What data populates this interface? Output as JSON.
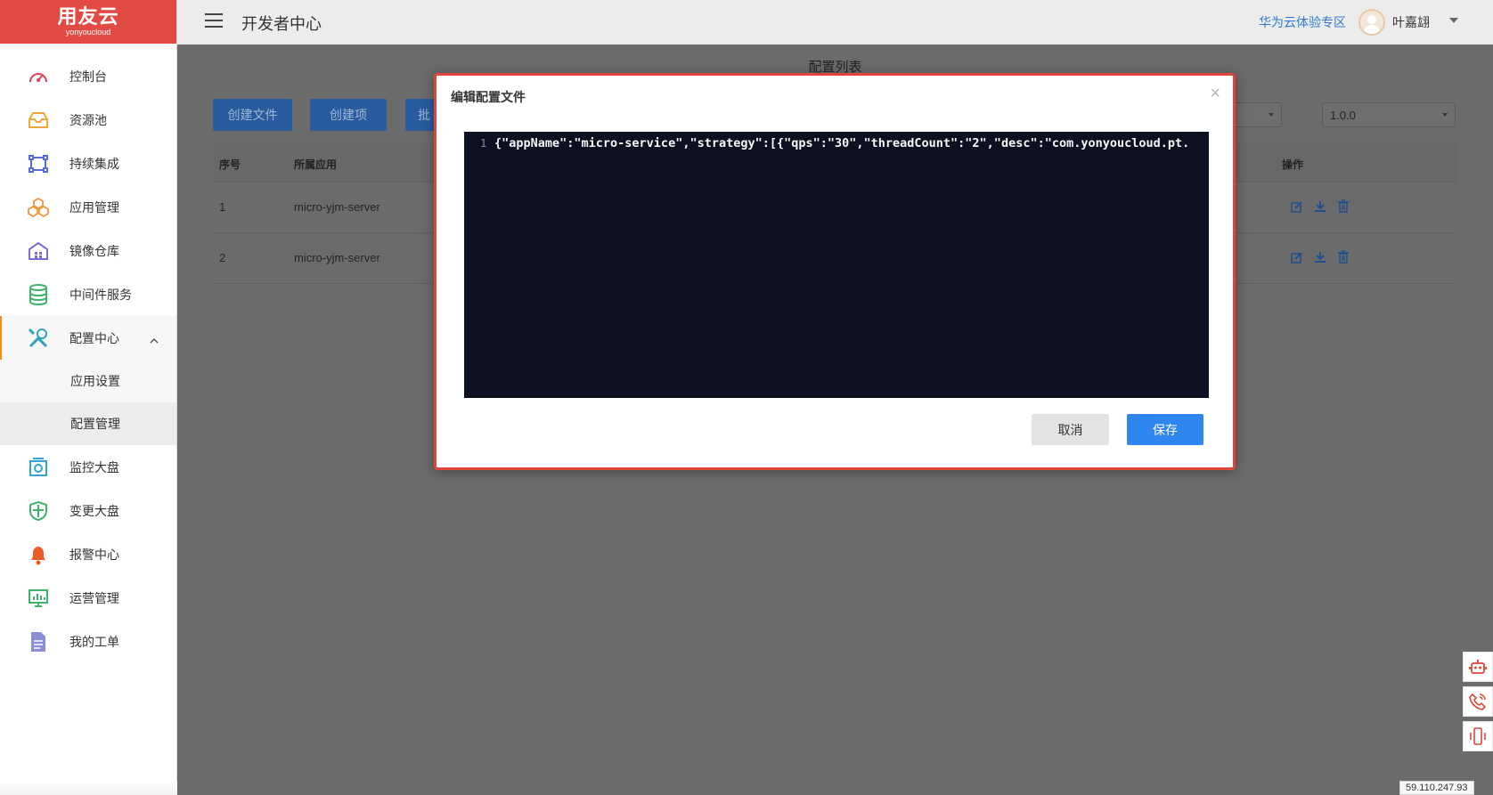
{
  "header": {
    "title": "开发者中心",
    "huawei_link": "华为云体验专区",
    "username": "叶嘉翃"
  },
  "logo": {
    "brand": "用友云",
    "sub": "yonyoucloud"
  },
  "sidebar": {
    "items": [
      {
        "label": "控制台",
        "icon": "dashboard-icon"
      },
      {
        "label": "资源池",
        "icon": "inbox-icon"
      },
      {
        "label": "持续集成",
        "icon": "integration-icon"
      },
      {
        "label": "应用管理",
        "icon": "cubes-icon"
      },
      {
        "label": "镜像仓库",
        "icon": "warehouse-icon"
      },
      {
        "label": "中间件服务",
        "icon": "database-icon"
      },
      {
        "label": "配置中心",
        "icon": "tools-icon"
      },
      {
        "label": "监控大盘",
        "icon": "monitor-icon"
      },
      {
        "label": "变更大盘",
        "icon": "shield-icon"
      },
      {
        "label": "报警中心",
        "icon": "bell-icon"
      },
      {
        "label": "运营管理",
        "icon": "chart-icon"
      },
      {
        "label": "我的工单",
        "icon": "document-icon"
      }
    ],
    "sub_items": [
      "应用设置",
      "配置管理"
    ]
  },
  "main": {
    "page_title": "配置列表",
    "buttons": {
      "create_file": "创建文件",
      "create_item": "创建项",
      "batch": "批"
    },
    "version_select": "1.0.0",
    "table": {
      "headers": {
        "index": "序号",
        "app": "所属应用",
        "ops": "操作"
      },
      "rows": [
        {
          "index": "1",
          "app": "micro-yjm-server"
        },
        {
          "index": "2",
          "app": "micro-yjm-server"
        }
      ]
    }
  },
  "modal": {
    "title": "编辑配置文件",
    "close": "×",
    "line_number": "1",
    "code": "{\"appName\":\"micro-service\",\"strategy\":[{\"qps\":\"30\",\"threadCount\":\"2\",\"desc\":\"com.yonyoucloud.pt.",
    "cancel": "取消",
    "save": "保存"
  },
  "footer": {
    "ip": "59.110.247.93"
  },
  "colors": {
    "brand_red": "#e14b43",
    "primary_blue": "#2f86ee",
    "link_blue": "#2f7bd3",
    "active_accent": "#f58a22"
  }
}
